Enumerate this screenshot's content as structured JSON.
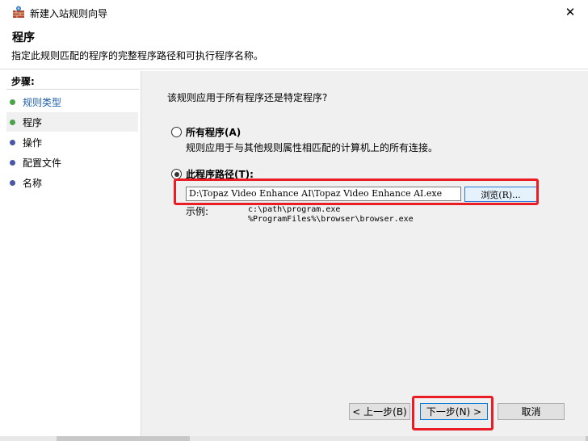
{
  "window": {
    "title": "新建入站规则向导",
    "close_glyph": "✕"
  },
  "header": {
    "title": "程序",
    "description": "指定此规则匹配的程序的完整程序路径和可执行程序名称。"
  },
  "steps": {
    "heading": "步骤:",
    "items": [
      {
        "label": "规则类型",
        "link": true,
        "active": false,
        "dot_color": "#4aa34a"
      },
      {
        "label": "程序",
        "link": false,
        "active": true,
        "dot_color": "#4aa34a"
      },
      {
        "label": "操作",
        "link": false,
        "active": false,
        "dot_color": "#4a56a8"
      },
      {
        "label": "配置文件",
        "link": false,
        "active": false,
        "dot_color": "#4a56a8"
      },
      {
        "label": "名称",
        "link": false,
        "active": false,
        "dot_color": "#4a56a8"
      }
    ]
  },
  "content": {
    "question": "该规则应用于所有程序还是特定程序?",
    "option_all": {
      "label": "所有程序(A)",
      "description": "规则应用于与其他规则属性相匹配的计算机上的所有连接。",
      "selected": false
    },
    "option_path": {
      "label": "此程序路径(T):",
      "selected": true,
      "value": "D:\\Topaz Video Enhance AI\\Topaz Video Enhance AI.exe",
      "browse_label": "浏览(R)..."
    },
    "example": {
      "label": "示例:",
      "lines": [
        "c:\\path\\program.exe",
        "%ProgramFiles%\\browser\\browser.exe"
      ]
    }
  },
  "footer": {
    "back_label": "< 上一步(B)",
    "next_label": "下一步(N) >",
    "cancel_label": "取消"
  },
  "colors": {
    "highlight": "#ea1c24",
    "link": "#1f5fa8",
    "focus": "#0078d7"
  },
  "icons": {
    "app": "firewall-wall-icon",
    "close": "close-icon"
  }
}
